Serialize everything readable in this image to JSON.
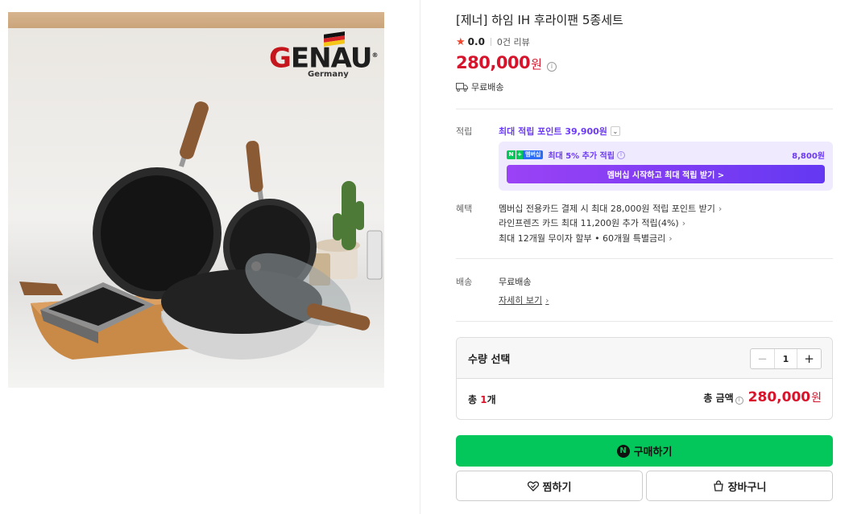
{
  "product": {
    "title": "[제너] 하임 IH 후라이팬 5종세트",
    "rating": "0.0",
    "review_count": "0건 리뷰",
    "price": "280,000",
    "price_unit": "원",
    "shipping_summary": "무료배송"
  },
  "image": {
    "brand_letter": "G",
    "brand_rest": "ENAU",
    "brand_sub": "Germany",
    "registered": "®"
  },
  "points": {
    "label": "적립",
    "max_points": "최대 적립 포인트 39,900원",
    "membership_text": "최대 5% 추가 적립",
    "membership_amount": "8,800원",
    "membership_button": "멤버십 시작하고 최대 적립 받기 >",
    "badge_n": "N",
    "badge_plus": "+",
    "badge_membership": "멤버십"
  },
  "benefits": {
    "label": "혜택",
    "items": [
      "멤버십 전용카드 결제 시 최대 28,000원 적립 포인트 받기",
      "라인프렌즈 카드 최대 11,200원 추가 적립(4%)",
      "최대 12개월 무이자 할부 • 60개월 특별금리"
    ]
  },
  "delivery": {
    "label": "배송",
    "value": "무료배송",
    "detail_link": "자세히 보기"
  },
  "quantity": {
    "label": "수량 선택",
    "value": "1",
    "minus": "−",
    "plus": "+"
  },
  "total": {
    "count_prefix": "총 ",
    "count": "1",
    "count_suffix": "개",
    "label": "총 금액",
    "amount": "280,000",
    "unit": "원"
  },
  "actions": {
    "buy_badge": "N",
    "buy_label": "구매하기",
    "wish_label": "찜하기",
    "cart_label": "장바구니"
  },
  "icons": {
    "star": "star-icon",
    "info": "info-icon",
    "truck": "truck-icon",
    "chevron": "chevron-right-icon",
    "heart": "heart-icon",
    "bag": "shopping-bag-icon"
  },
  "colors": {
    "price_red": "#d6152c",
    "naver_green": "#03c75a",
    "membership_purple": "#6d3bf5"
  }
}
